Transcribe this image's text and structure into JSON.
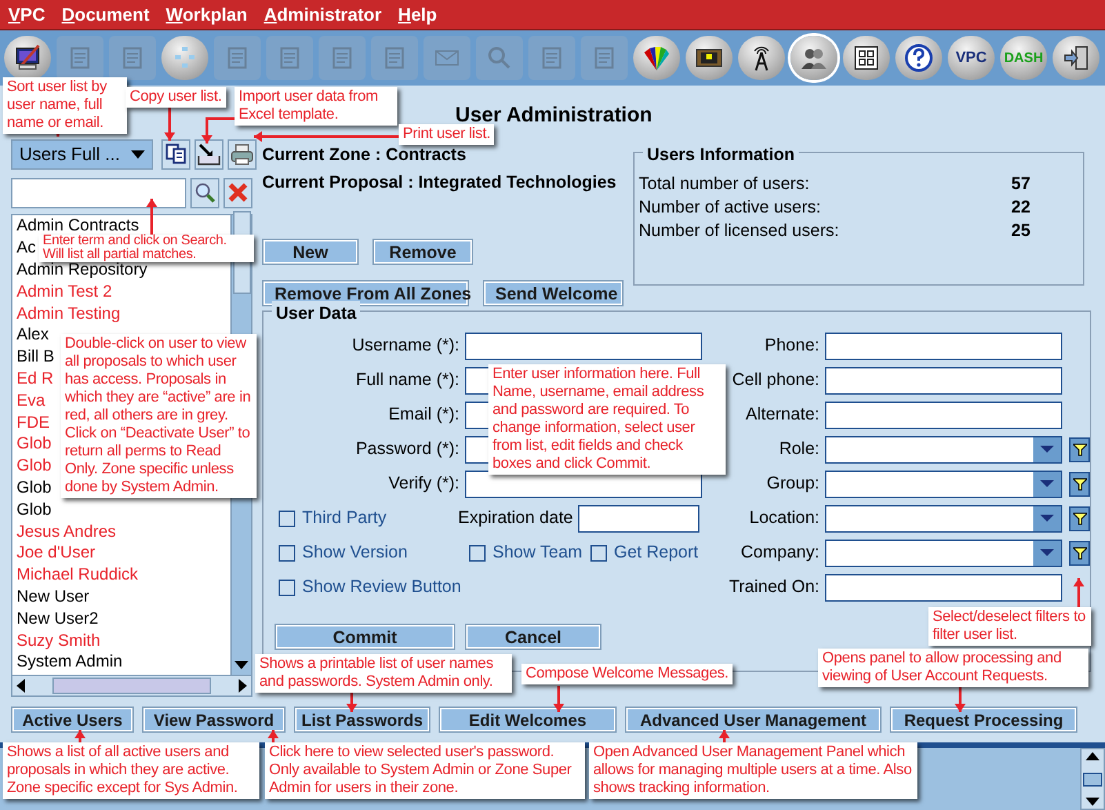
{
  "menu": [
    {
      "label": "VPC"
    },
    {
      "label": "Document"
    },
    {
      "label": "Workplan"
    },
    {
      "label": "Administrator"
    },
    {
      "label": "Help"
    }
  ],
  "toolbar": [
    {
      "disabled": false,
      "selected": false
    },
    {
      "disabled": true,
      "selected": false
    },
    {
      "disabled": true,
      "selected": false
    },
    {
      "disabled": false,
      "selected": false
    },
    {
      "disabled": true,
      "selected": false
    },
    {
      "disabled": true,
      "selected": false
    },
    {
      "disabled": true,
      "selected": false
    },
    {
      "disabled": true,
      "selected": false
    },
    {
      "disabled": true,
      "selected": false
    },
    {
      "disabled": true,
      "selected": false
    },
    {
      "disabled": true,
      "selected": false
    },
    {
      "disabled": true,
      "selected": false
    },
    {
      "disabled": false,
      "selected": false
    },
    {
      "disabled": false,
      "selected": false
    },
    {
      "disabled": false,
      "selected": false
    },
    {
      "disabled": false,
      "selected": true
    },
    {
      "disabled": false,
      "selected": false
    },
    {
      "disabled": false,
      "selected": false
    },
    {
      "disabled": false,
      "selected": false,
      "label": "VPC"
    },
    {
      "disabled": false,
      "selected": false,
      "label": "DASH"
    },
    {
      "disabled": false,
      "selected": false
    }
  ],
  "title": "User Administration",
  "sort_dropdown": {
    "value": "Users Full ..."
  },
  "user_list": [
    {
      "name": "Admin Contracts",
      "active": false,
      "selected": false
    },
    {
      "name": "Ac",
      "active": false,
      "selected": false
    },
    {
      "name": "Admin Repository",
      "active": false,
      "selected": false
    },
    {
      "name": "Admin Test 2",
      "active": true,
      "selected": false
    },
    {
      "name": "Admin Testing",
      "active": true,
      "selected": false
    },
    {
      "name": "Alex",
      "active": false,
      "selected": false
    },
    {
      "name": "Bill B",
      "active": false,
      "selected": false
    },
    {
      "name": "Ed R",
      "active": true,
      "selected": false
    },
    {
      "name": "Eva",
      "active": true,
      "selected": false
    },
    {
      "name": "FDE",
      "active": true,
      "selected": false
    },
    {
      "name": "Glob",
      "active": true,
      "selected": false
    },
    {
      "name": "Glob",
      "active": true,
      "selected": false
    },
    {
      "name": "Glob",
      "active": false,
      "selected": false
    },
    {
      "name": "Glob",
      "active": false,
      "selected": false
    },
    {
      "name": "Jesus Andres",
      "active": true,
      "selected": false
    },
    {
      "name": "Joe d'User",
      "active": true,
      "selected": false
    },
    {
      "name": "Michael Ruddick",
      "active": true,
      "selected": false
    },
    {
      "name": "New User",
      "active": false,
      "selected": false
    },
    {
      "name": "New User2",
      "active": false,
      "selected": false
    },
    {
      "name": "Suzy Smith",
      "active": true,
      "selected": false
    },
    {
      "name": "System Admin",
      "active": false,
      "selected": false
    }
  ],
  "current_zone": "Current Zone : Contracts",
  "current_proposal": "Current Proposal : Integrated Technologies",
  "top_buttons": [
    {
      "label": "New"
    },
    {
      "label": "Remove"
    }
  ],
  "zone_buttons": [
    {
      "label": "Remove From All Zones"
    },
    {
      "label": "Send Welcome"
    }
  ],
  "users_information": {
    "title": "Users Information",
    "rows": [
      {
        "label": "Total number of users:",
        "value": "57"
      },
      {
        "label": "Number of active users:",
        "value": "22"
      },
      {
        "label": "Number of licensed users:",
        "value": "25"
      }
    ]
  },
  "user_data": {
    "title": "User Data",
    "left_fields": [
      {
        "label": "Username (*):"
      },
      {
        "label": "Full name (*):"
      },
      {
        "label": "Email (*):"
      },
      {
        "label": "Password (*):"
      },
      {
        "label": "Verify (*):"
      }
    ],
    "third_party": {
      "label": "Third Party",
      "checked": false
    },
    "expiration_date": {
      "label": "Expiration date"
    },
    "show_version": {
      "label": "Show Version",
      "checked": false
    },
    "show_team": {
      "label": "Show Team",
      "checked": false
    },
    "get_report": {
      "label": "Get Report",
      "checked": false
    },
    "show_review_button": {
      "label": "Show Review Button",
      "checked": false
    },
    "right_fields": [
      {
        "label": "Phone:",
        "kind": "text"
      },
      {
        "label": "Cell phone:",
        "kind": "text"
      },
      {
        "label": "Alternate:",
        "kind": "text"
      },
      {
        "label": "Role:",
        "kind": "combo"
      },
      {
        "label": "Group:",
        "kind": "combo"
      },
      {
        "label": "Location:",
        "kind": "combo"
      },
      {
        "label": "Company:",
        "kind": "combo"
      },
      {
        "label": "Trained On:",
        "kind": "text"
      }
    ],
    "buttons": [
      {
        "label": "Commit"
      },
      {
        "label": "Cancel"
      }
    ]
  },
  "bottom_buttons": [
    {
      "label": "Active Users"
    },
    {
      "label": "View Password"
    },
    {
      "label": "List Passwords"
    },
    {
      "label": "Edit Welcomes"
    },
    {
      "label": "Advanced User Management"
    },
    {
      "label": "Request Processing"
    }
  ],
  "annotations": [
    {
      "text": "Sort user list by user name, full name or email."
    },
    {
      "text": "Copy user list."
    },
    {
      "text": "Import user data from Excel template."
    },
    {
      "text": "Print user list."
    },
    {
      "text": "Enter term and click on Search. Will list all partial matches."
    },
    {
      "text": "Double-click on user to view all proposals to which user has access. Proposals in which they are “active” are in red, all others are in grey. Click on “Deactivate User” to return all perms to Read Only. Zone specific unless done by System Admin."
    },
    {
      "text": "Enter user information here. Full Name, username, email address and password are required. To change information, select user from list, edit fields and check boxes and click Commit."
    },
    {
      "text": "Select/deselect filters to filter user list."
    },
    {
      "text": "Shows a printable list of user names and passwords. System Admin only."
    },
    {
      "text": "Compose Welcome Messages."
    },
    {
      "text": "Opens panel to allow processing and viewing of User Account Requests."
    },
    {
      "text": "Shows a list of all active users and proposals in which they are active. Zone specific except for Sys Admin."
    },
    {
      "text": "Click here to view selected user's password. Only available to System Admin or Zone Super Admin for users in their zone."
    },
    {
      "text": "Open Advanced User Management Panel which allows for managing multiple users at a time. Also shows tracking information."
    }
  ]
}
